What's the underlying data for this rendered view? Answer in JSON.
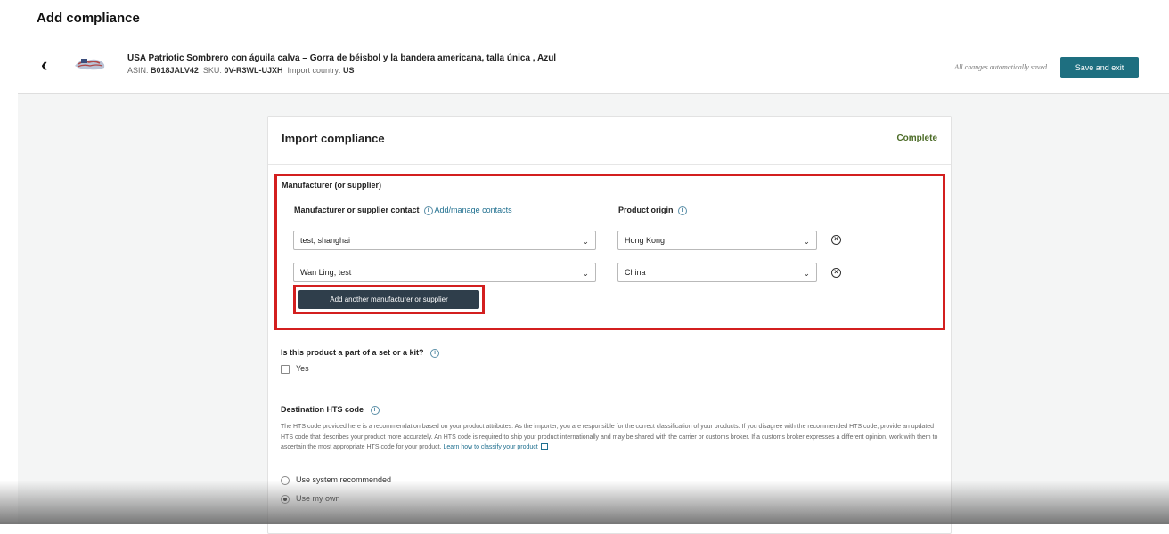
{
  "page": {
    "title": "Add compliance"
  },
  "product": {
    "title": "USA Patriotic Sombrero con águila calva – Gorra de béisbol y la bandera americana, talla única , Azul",
    "asin_label": "ASIN:",
    "asin": "B018JALV42",
    "sku_label": "SKU:",
    "sku": "0V-R3WL-UJXH",
    "import_country_label": "Import country:",
    "import_country": "US"
  },
  "toolbar": {
    "autosave_text": "All changes automatically saved",
    "save_exit_label": "Save and exit"
  },
  "card": {
    "title": "Import compliance",
    "status": "Complete",
    "status_color": "#4b6b26"
  },
  "manufacturer": {
    "section_label": "Manufacturer (or supplier)",
    "contact_label": "Manufacturer or supplier contact",
    "manage_link": "Add/manage contacts",
    "origin_label": "Product origin",
    "rows": [
      {
        "contact": "test, shanghai",
        "origin": "Hong Kong"
      },
      {
        "contact": "Wan Ling, test",
        "origin": "China"
      }
    ],
    "add_button_label": "Add another manufacturer or supplier",
    "highlight_color": "#d31f1f"
  },
  "set_kit": {
    "question": "Is this product a part of a set or a kit?",
    "option_label": "Yes",
    "checked": false
  },
  "hts": {
    "title": "Destination HTS code",
    "description": "The HTS code provided here is a recommendation based on your product attributes. As the importer, you are responsible for the correct classification of your products. If you disagree with the recommended HTS code, provide an updated HTS code that describes your product more accurately. An HTS code is required to ship your product internationally and may be shared with the carrier or customs broker. If a customs broker expresses a different opinion, work with them to ascertain the most appropriate HTS code for your product.",
    "learn_link": "Learn how to classify your product",
    "options": [
      {
        "label": "Use system recommended",
        "selected": false
      },
      {
        "label": "Use my own",
        "selected": true
      }
    ]
  },
  "icons": {
    "back": "chevron-left-icon",
    "info": "info-icon",
    "dropdown": "chevron-down-icon",
    "remove": "remove-circle-icon",
    "external": "external-link-icon"
  },
  "colors": {
    "primary_button": "#1e6f80",
    "dark_button": "#2f3e4b",
    "link": "#1f6f8f"
  }
}
